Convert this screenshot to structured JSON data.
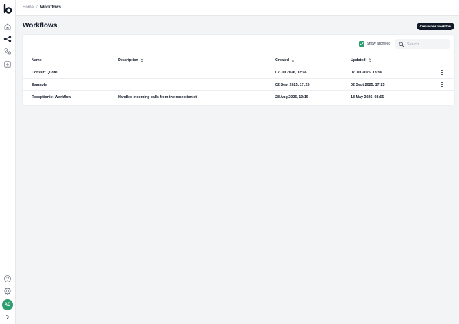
{
  "sidebar": {
    "logo_icon": "brand-logo-icon",
    "nav_icons": [
      "home-icon",
      "workflow-icon",
      "phone-icon",
      "plus-square-icon"
    ],
    "bottom_icons": [
      "help-icon",
      "gear-icon"
    ],
    "avatar_initials": "AD",
    "expand_icon": "chevron-right-icon"
  },
  "breadcrumb": {
    "home": "Home",
    "separator": "/",
    "current": "Workflows"
  },
  "page": {
    "title": "Workflows",
    "create_button": "Create new workflow"
  },
  "filters": {
    "show_archived_label": "Show archived",
    "show_archived_checked": true,
    "search_placeholder": "Search..."
  },
  "table": {
    "columns": [
      "Name",
      "Description",
      "Created",
      "Updated"
    ],
    "rows": [
      {
        "name": "Convert Quote",
        "description": "",
        "created": "07 Jul 2026, 13:56",
        "updated": "07 Jul 2026, 13:56"
      },
      {
        "name": "Example",
        "description": "",
        "created": "02 Sept 2025, 17:25",
        "updated": "02 Sept 2025, 17:25"
      },
      {
        "name": "Receptionist Workflow",
        "description": "Handles incoming calls from the receptionist",
        "created": "28 Aug 2025, 10:15",
        "updated": "18 May 2026, 08:55"
      }
    ]
  },
  "colors": {
    "accent_green": "#2f9e6f",
    "button_dark": "#111827"
  }
}
